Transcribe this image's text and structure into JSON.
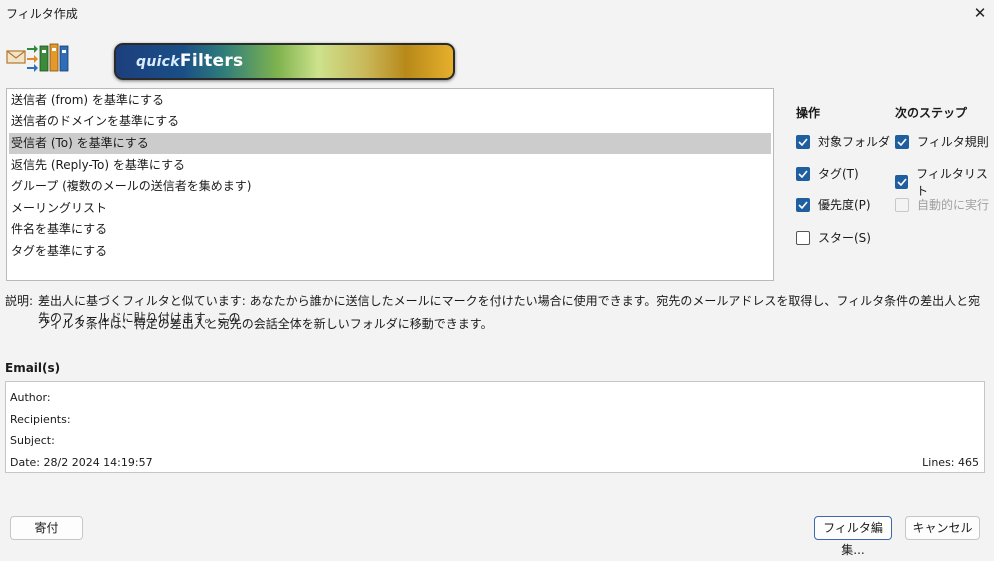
{
  "window": {
    "title": "フィルタ作成",
    "close_glyph": "✕"
  },
  "banner": {
    "quick": "quick",
    "filters": "Filters"
  },
  "templates": {
    "selected_index": 2,
    "items": [
      "送信者 (from) を基準にする",
      "送信者のドメインを基準にする",
      "受信者 (To) を基準にする",
      "返信先 (Reply-To) を基準にする",
      "グループ (複数のメールの送信者を集めます)",
      "メーリングリスト",
      "件名を基準にする",
      "タグを基準にする"
    ]
  },
  "actions": {
    "header": "操作",
    "items": [
      {
        "label": "対象フォルダ",
        "checked": true
      },
      {
        "label": "タグ(T)",
        "checked": true
      },
      {
        "label": "優先度(P)",
        "checked": true
      },
      {
        "label": "スター(S)",
        "checked": false
      }
    ]
  },
  "next_steps": {
    "header": "次のステップ",
    "items": [
      {
        "label": "フィルタ規則",
        "checked": true,
        "disabled": false
      },
      {
        "label": "フィルタリスト",
        "checked": true,
        "disabled": false
      },
      {
        "label": "自動的に実行",
        "checked": false,
        "disabled": true
      }
    ]
  },
  "description": {
    "label": "説明:",
    "line1": "差出人に基づくフィルタと似ています: あなたから誰かに送信したメールにマークを付けたい場合に使用できます。宛先のメールアドレスを取得し、フィルタ条件の差出人と宛先のフィールドに貼り付けます。この",
    "line2": "フィルタ条件は、特定の差出人と宛先の会話全体を新しいフォルダに移動できます。"
  },
  "emails": {
    "header": "Email(s)",
    "author": "Author:",
    "recipients": "Recipients:",
    "subject": "Subject:",
    "date": "Date: 28/2 2024 14:19:57",
    "lines": "Lines: 465"
  },
  "buttons": {
    "donate": "寄付",
    "edit_filter": "フィルタ編集...",
    "cancel": "キャンセル"
  },
  "colors": {
    "checkbox_accent": "#1f5f9f",
    "selected_row": "#cccccc"
  },
  "icons": [
    "envelope-icon",
    "arrows-icon",
    "folders-icon",
    "checkmark-icon",
    "close-icon"
  ]
}
